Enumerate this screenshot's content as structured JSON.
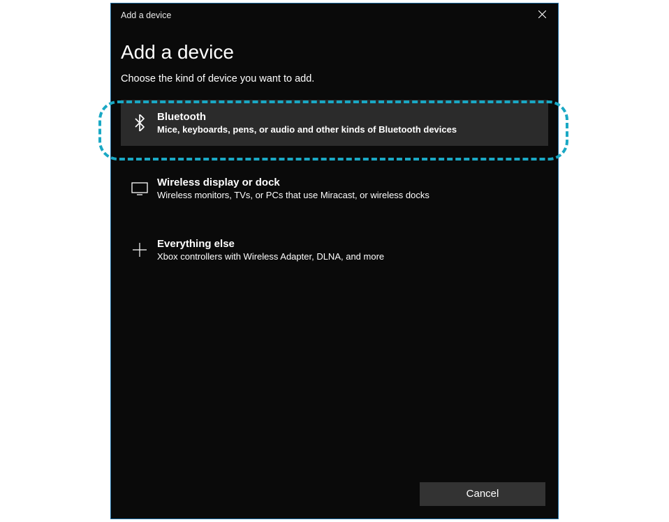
{
  "titlebar": {
    "title": "Add a device"
  },
  "page": {
    "heading": "Add a device",
    "subtitle": "Choose the kind of device you want to add."
  },
  "options": [
    {
      "icon": "bluetooth",
      "title": "Bluetooth",
      "desc": "Mice, keyboards, pens, or audio and other kinds of Bluetooth devices",
      "highlighted": true
    },
    {
      "icon": "monitor",
      "title": "Wireless display or dock",
      "desc": "Wireless monitors, TVs, or PCs that use Miracast, or wireless docks",
      "highlighted": false
    },
    {
      "icon": "plus",
      "title": "Everything else",
      "desc": "Xbox controllers with Wireless Adapter, DLNA, and more",
      "highlighted": false
    }
  ],
  "footer": {
    "cancel": "Cancel"
  },
  "annotation": {
    "highlight_color": "#1aa8c4"
  }
}
